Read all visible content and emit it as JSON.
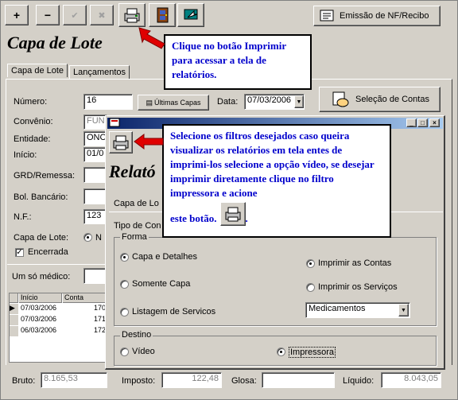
{
  "toolbar": {
    "add_label": "+",
    "remove_label": "−",
    "confirm_label": "✔",
    "cancel_label": "✖",
    "emission_label": "Emissão de NF/Recibo"
  },
  "main": {
    "title": "Capa de Lote",
    "tabs": [
      "Capa de Lote",
      "Lançamentos"
    ],
    "numero_label": "Número:",
    "numero_value": "16",
    "ultimas_capas_label": "Últimas Capas",
    "data_label": "Data:",
    "data_value": "07/03/2006",
    "selecao_contas_label": "Seleção de Contas",
    "convenio_label": "Convênio:",
    "convenio_value": "FUN",
    "entidade_label": "Entidade:",
    "entidade_value": "ONC",
    "inicio_label": "Início:",
    "inicio_value": "01/0",
    "grd_label": "GRD/Remessa:",
    "bol_label": "Bol. Bancário:",
    "nf_label": "N.F.:",
    "nf_value": "123",
    "capa_lote_label": "Capa de Lote:",
    "capa_lote_radio": "N",
    "encerrada_label": "Encerrada",
    "um_so_medico_label": "Um só médico:",
    "grid": {
      "headers": [
        "Início",
        "Conta"
      ],
      "rows": [
        [
          "07/03/2006",
          "170"
        ],
        [
          "07/03/2006",
          "171"
        ],
        [
          "06/03/2006",
          "172"
        ]
      ]
    },
    "bruto_label": "Bruto:",
    "bruto_value": "8.165,53",
    "imposto_label": "Imposto:",
    "imposto_value": "122,48",
    "glosa_label": "Glosa:",
    "liquido_label": "Líquido:",
    "liquido_value": "8.043,05"
  },
  "dialog": {
    "title": "Relatórios",
    "title_visible": "Relató",
    "capa_label": "Capa de Lo",
    "tipo_label": "Tipo de Con",
    "forma_label": "Forma",
    "opt_capa_detalhes": "Capa e Detalhes",
    "opt_somente_capa": "Somente Capa",
    "opt_listagem": "Listagem de Servicos",
    "opt_imprimir_contas": "Imprimir as Contas",
    "opt_imprimir_servicos": "Imprimir os Serviços",
    "select_value": "Medicamentos",
    "destino_label": "Destino",
    "opt_video": "Vídeo",
    "opt_impressora": "Impressora",
    "win_buttons": [
      "_",
      "□",
      "×"
    ]
  },
  "tips": {
    "tip1": "Clique no botão Imprimir para acessar a tela de relatórios.",
    "tip2_text": "Selecione os filtros desejados caso queira visualizar os relatórios em tela entes de imprimi-los selecione a opção vídeo, se desejar imprimir diretamente clique no filtro impressora e acione",
    "tip2_end": "este botão.",
    "tip2_end_punct": "."
  },
  "colors": {
    "window_bg": "#d4d0c8",
    "tip_text": "#0000cc",
    "arrow": "#e00000",
    "title_bar": "#0a246a"
  }
}
